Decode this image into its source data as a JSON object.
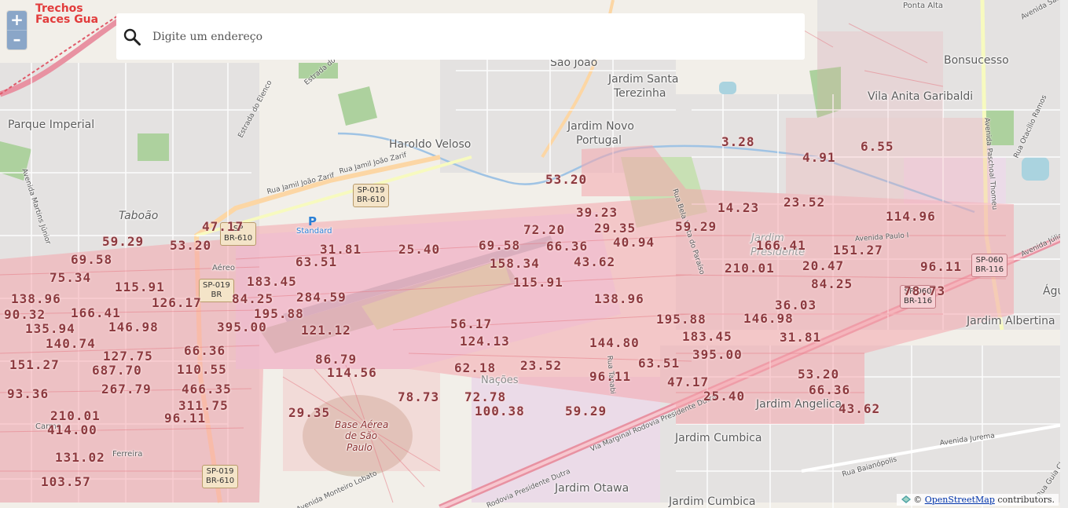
{
  "layer_title": {
    "line1": "Trechos",
    "line2": "Faces Gua"
  },
  "zoom": {
    "in_label": "+",
    "out_label": "–"
  },
  "search": {
    "placeholder": "Digite um endereço",
    "icon": "search-icon"
  },
  "attribution": {
    "prefix": "©",
    "link": "OpenStreetMap",
    "suffix": "contributors."
  },
  "colors": {
    "overlay": "#f4a7ad",
    "value_text": "#8c3a3f",
    "zoom_bg": "#8aa6c8",
    "title_red": "#e23c3c"
  },
  "places": [
    "Parque Imperial",
    "Taboão",
    "São João",
    "Jardim Santa",
    "Terezinha",
    "Jardim Novo",
    "Portugal",
    "Haroldo Veloso",
    "Bonsucesso",
    "Vila Anita Garibaldi",
    "Ponta Alta",
    "Jardim Albertina",
    "Jardim Angelica",
    "Jardim Cumbica",
    "Jardim Otawa",
    "Jardim Cumbica",
    "Base Aérea",
    "de São",
    "Paulo",
    "Jardim",
    "Presidente",
    "Nações",
    "Standard",
    "Águ",
    "Aéreo",
    "Carmo",
    "Ferreira"
  ],
  "streets": [
    "Estrada do Elenco",
    "Estrada do Elenco",
    "Rua Jamil João Zarif",
    "Rua Jamil João Zarif",
    "Avenida Martins Júnior",
    "Rua Bela Vista do Paraíso",
    "Rua Tanabi",
    "Avenida Paschoal Thomeu",
    "Rua Otacílio Ramos",
    "Rodovia Presidente Dutra",
    "Via Marginal Rodovia Presidente Dutra",
    "Avenida Monteiro Lobato",
    "Rua Baianópolis",
    "Avenida Jurema",
    "Avenida Júlia",
    "Avenida Santos Dumont",
    "Avenida Paulo I",
    "Rua Guia Chaves"
  ],
  "shields": [
    {
      "line1": "SP-019",
      "line2": "BR-610"
    },
    {
      "line1": "SP",
      "line2": "BR-610"
    },
    {
      "line1": "SP-019",
      "line2": "BR"
    },
    {
      "line1": "SP-019",
      "line2": "BR-610"
    },
    {
      "line1": "SP-060",
      "line2": "BR-116"
    },
    {
      "line1": "SP-060",
      "line2": "BR-116"
    }
  ],
  "values": [
    "53.20",
    "3.28",
    "4.91",
    "6.55",
    "39.23",
    "14.23",
    "23.52",
    "114.96",
    "47.17",
    "59.29",
    "53.20",
    "72.20",
    "29.35",
    "59.29",
    "31.81",
    "25.40",
    "69.58",
    "66.36",
    "40.94",
    "166.41",
    "151.27",
    "69.58",
    "63.51",
    "158.34",
    "43.62",
    "210.01",
    "20.47",
    "96.11",
    "75.34",
    "183.45",
    "115.91",
    "84.25",
    "115.91",
    "126.17",
    "84.25",
    "284.59",
    "78.73",
    "138.96",
    "90.32",
    "166.41",
    "195.88",
    "36.03",
    "138.96",
    "135.94",
    "146.98",
    "395.00",
    "121.12",
    "56.17",
    "195.88",
    "146.98",
    "140.74",
    "66.36",
    "124.13",
    "144.80",
    "183.45",
    "31.81",
    "151.27",
    "127.75",
    "86.79",
    "395.00",
    "687.70",
    "110.55",
    "114.56",
    "62.18",
    "23.52",
    "63.51",
    "53.20",
    "96.11",
    "47.17",
    "93.36",
    "267.79",
    "466.35",
    "66.36",
    "78.73",
    "72.78",
    "25.40",
    "311.75",
    "29.35",
    "100.38",
    "59.29",
    "43.62",
    "210.01",
    "96.11",
    "414.00",
    "131.02",
    "103.57"
  ]
}
